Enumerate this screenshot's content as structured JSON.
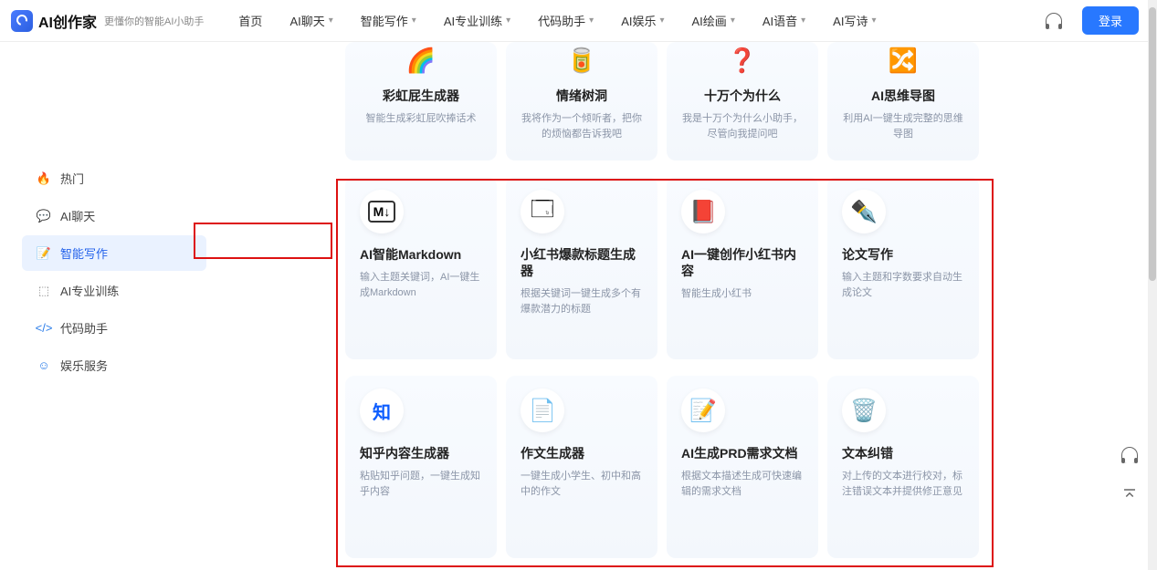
{
  "header": {
    "title": "AI创作家",
    "subtitle": "更懂你的智能AI小助手",
    "login": "登录",
    "nav": [
      {
        "label": "首页",
        "dropdown": false,
        "active": false
      },
      {
        "label": "AI聊天",
        "dropdown": true,
        "active": false
      },
      {
        "label": "智能写作",
        "dropdown": true,
        "active": false
      },
      {
        "label": "AI专业训练",
        "dropdown": true,
        "active": false
      },
      {
        "label": "代码助手",
        "dropdown": true,
        "active": false
      },
      {
        "label": "AI娱乐",
        "dropdown": true,
        "active": false
      },
      {
        "label": "AI绘画",
        "dropdown": true,
        "active": false
      },
      {
        "label": "AI语音",
        "dropdown": true,
        "active": false
      },
      {
        "label": "AI写诗",
        "dropdown": true,
        "active": false
      }
    ]
  },
  "sidebar": [
    {
      "icon": "fire",
      "color": "#ff9800",
      "label": "热门"
    },
    {
      "icon": "chat",
      "color": "#3fa9f5",
      "label": "AI聊天"
    },
    {
      "icon": "doc",
      "color": "#2563eb",
      "label": "智能写作",
      "active": true
    },
    {
      "icon": "cube",
      "color": "#888",
      "label": "AI专业训练"
    },
    {
      "icon": "code",
      "color": "#2b7de9",
      "label": "代码助手"
    },
    {
      "icon": "smile",
      "color": "#2b7de9",
      "label": "娱乐服务"
    }
  ],
  "row1": [
    {
      "icon": "🌈",
      "title": "彩虹屁生成器",
      "desc": "智能生成彩虹屁吹捧话术"
    },
    {
      "icon": "🥫",
      "title": "情绪树洞",
      "desc": "我将作为一个倾听者，把你的烦恼都告诉我吧"
    },
    {
      "icon": "❓",
      "title": "十万个为什么",
      "desc": "我是十万个为什么小助手，尽管向我提问吧"
    },
    {
      "icon": "🔀",
      "title": "AI思维导图",
      "desc": "利用AI一键生成完整的思维导图"
    }
  ],
  "row2": [
    {
      "icon": "M↓",
      "title": "AI智能Markdown",
      "desc": "输入主题关键词，AI一键生成Markdown"
    },
    {
      "icon": "🗔",
      "title": "小红书爆款标题生成器",
      "desc": "根据关键词一键生成多个有爆款潜力的标题"
    },
    {
      "icon": "📕",
      "title": "AI一键创作小红书内容",
      "desc": "智能生成小红书"
    },
    {
      "icon": "✒️",
      "title": "论文写作",
      "desc": "输入主题和字数要求自动生成论文"
    }
  ],
  "row3": [
    {
      "icon": "知",
      "title": "知乎内容生成器",
      "desc": "粘贴知乎问题，一键生成知乎内容"
    },
    {
      "icon": "📄",
      "title": "作文生成器",
      "desc": "一键生成小学生、初中和高中的作文"
    },
    {
      "icon": "📝",
      "title": "AI生成PRD需求文档",
      "desc": "根据文本描述生成可快速编辑的需求文档"
    },
    {
      "icon": "🗑️",
      "title": "文本纠错",
      "desc": "对上传的文本进行校对，标注错误文本并提供修正意见"
    }
  ]
}
